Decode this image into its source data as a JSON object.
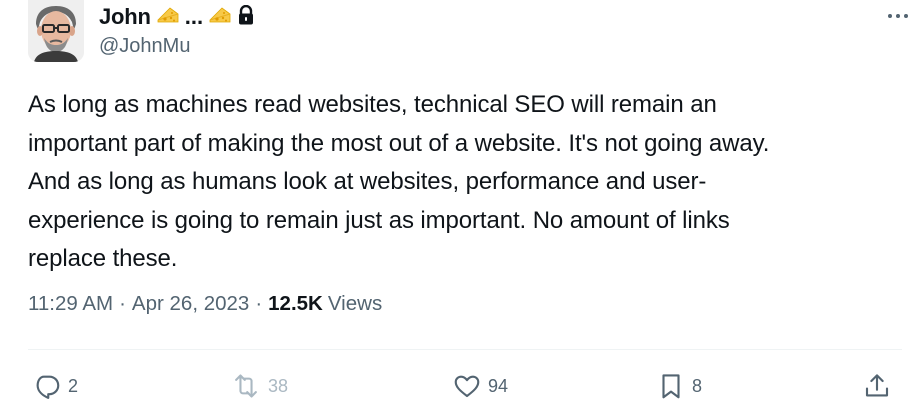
{
  "author": {
    "name": "John",
    "name_suffix": "...",
    "handle": "@JohnMu",
    "emoji_icon": "cheese-icon",
    "lock_icon": "lock-icon"
  },
  "tweet": {
    "text": "As long as machines read websites, technical SEO will remain an\nimportant part of making the most out of a website. It's not going away.\nAnd as long as humans look at websites, performance and user-\nexperience is going to remain just as important. No amount of links\nreplace these."
  },
  "meta": {
    "time": "11:29 AM",
    "date": "Apr 26, 2023",
    "separator": "·",
    "views_count": "12.5K",
    "views_label": "Views"
  },
  "actions": {
    "replies": "2",
    "reposts": "38",
    "likes": "94",
    "bookmarks": "8"
  },
  "colors": {
    "text_primary": "#0f1419",
    "text_secondary": "#536471",
    "divider": "#eff3f4",
    "action_disabled": "#aab8c2"
  }
}
